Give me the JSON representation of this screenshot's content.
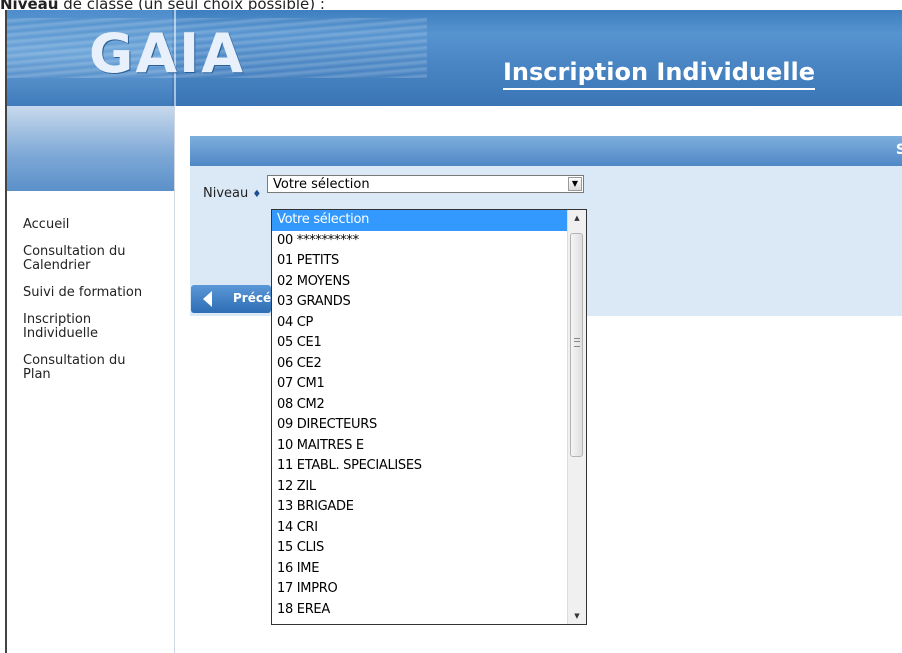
{
  "top_caption": {
    "bold": "Niveau",
    "rest": " de classe (un seul choix possible) :"
  },
  "header": {
    "logo": "GAIA",
    "title": "Inscription Individuelle",
    "corner_letter": "S"
  },
  "sidebar": {
    "items": [
      {
        "label": "Accueil"
      },
      {
        "label": "Consultation du Calendrier"
      },
      {
        "label": "Suivi de formation"
      },
      {
        "label": "Inscription Individuelle"
      },
      {
        "label": "Consultation du Plan"
      }
    ]
  },
  "form": {
    "niveau_label": "Niveau",
    "required_mark": "♦",
    "selected_value": "Votre sélection",
    "prev_button_label": "Précédent"
  },
  "dropdown": {
    "options": [
      "Votre sélection",
      "00 **********",
      "01 PETITS",
      "02 MOYENS",
      "03 GRANDS",
      "04 CP",
      "05 CE1",
      "06 CE2",
      "07 CM1",
      "08 CM2",
      "09 DIRECTEURS",
      "10 MAITRES E",
      "11 ETABL. SPECIALISES",
      "12 ZIL",
      "13 BRIGADE",
      "14 CRI",
      "15 CLIS",
      "16 IME",
      "17 IMPRO",
      "18 EREA"
    ],
    "highlighted_index": 0
  },
  "colors": {
    "header_blue": "#4a86c4",
    "content_bg": "#dbe8f5",
    "selection": "#3399ff"
  }
}
